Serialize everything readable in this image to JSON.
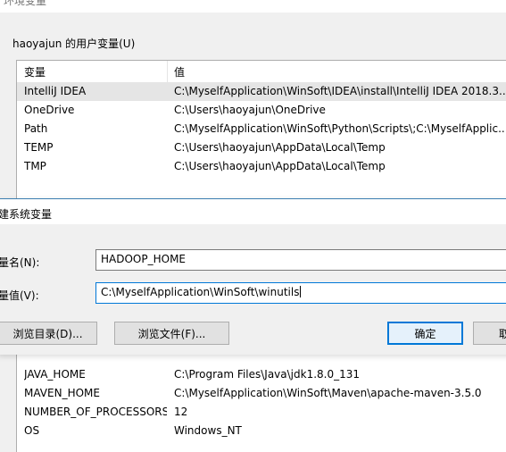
{
  "window": {
    "title": "环境变量"
  },
  "user_vars": {
    "group_label": "haoyajun 的用户变量(U)",
    "columns": [
      "变量",
      "值"
    ],
    "rows": [
      {
        "name": "IntelliJ IDEA",
        "value": "C:\\MyselfApplication\\WinSoft\\IDEA\\install\\IntelliJ IDEA 2018.3..."
      },
      {
        "name": "OneDrive",
        "value": "C:\\Users\\haoyajun\\OneDrive"
      },
      {
        "name": "Path",
        "value": "C:\\MyselfApplication\\WinSoft\\Python\\Scripts\\;C:\\MyselfApplic..."
      },
      {
        "name": "TEMP",
        "value": "C:\\Users\\haoyajun\\AppData\\Local\\Temp"
      },
      {
        "name": "TMP",
        "value": "C:\\Users\\haoyajun\\AppData\\Local\\Temp"
      }
    ]
  },
  "dialog": {
    "title": "建系统变量",
    "name_label": "量名(N):",
    "value_label": "量值(V):",
    "name_value": "HADOOP_HOME",
    "value_value": "C:\\MyselfApplication\\WinSoft\\winutils",
    "browse_dir": "浏览目录(D)...",
    "browse_file": "浏览文件(F)...",
    "ok": "确定",
    "cancel": "取"
  },
  "system_vars": {
    "rows": [
      {
        "name": "JAVA_HOME",
        "value": "C:\\Program Files\\Java\\jdk1.8.0_131"
      },
      {
        "name": "MAVEN_HOME",
        "value": "C:\\MyselfApplication\\WinSoft\\Maven\\apache-maven-3.5.0"
      },
      {
        "name": "NUMBER_OF_PROCESSORS",
        "value": "12"
      },
      {
        "name": "OS",
        "value": "Windows_NT"
      }
    ]
  }
}
